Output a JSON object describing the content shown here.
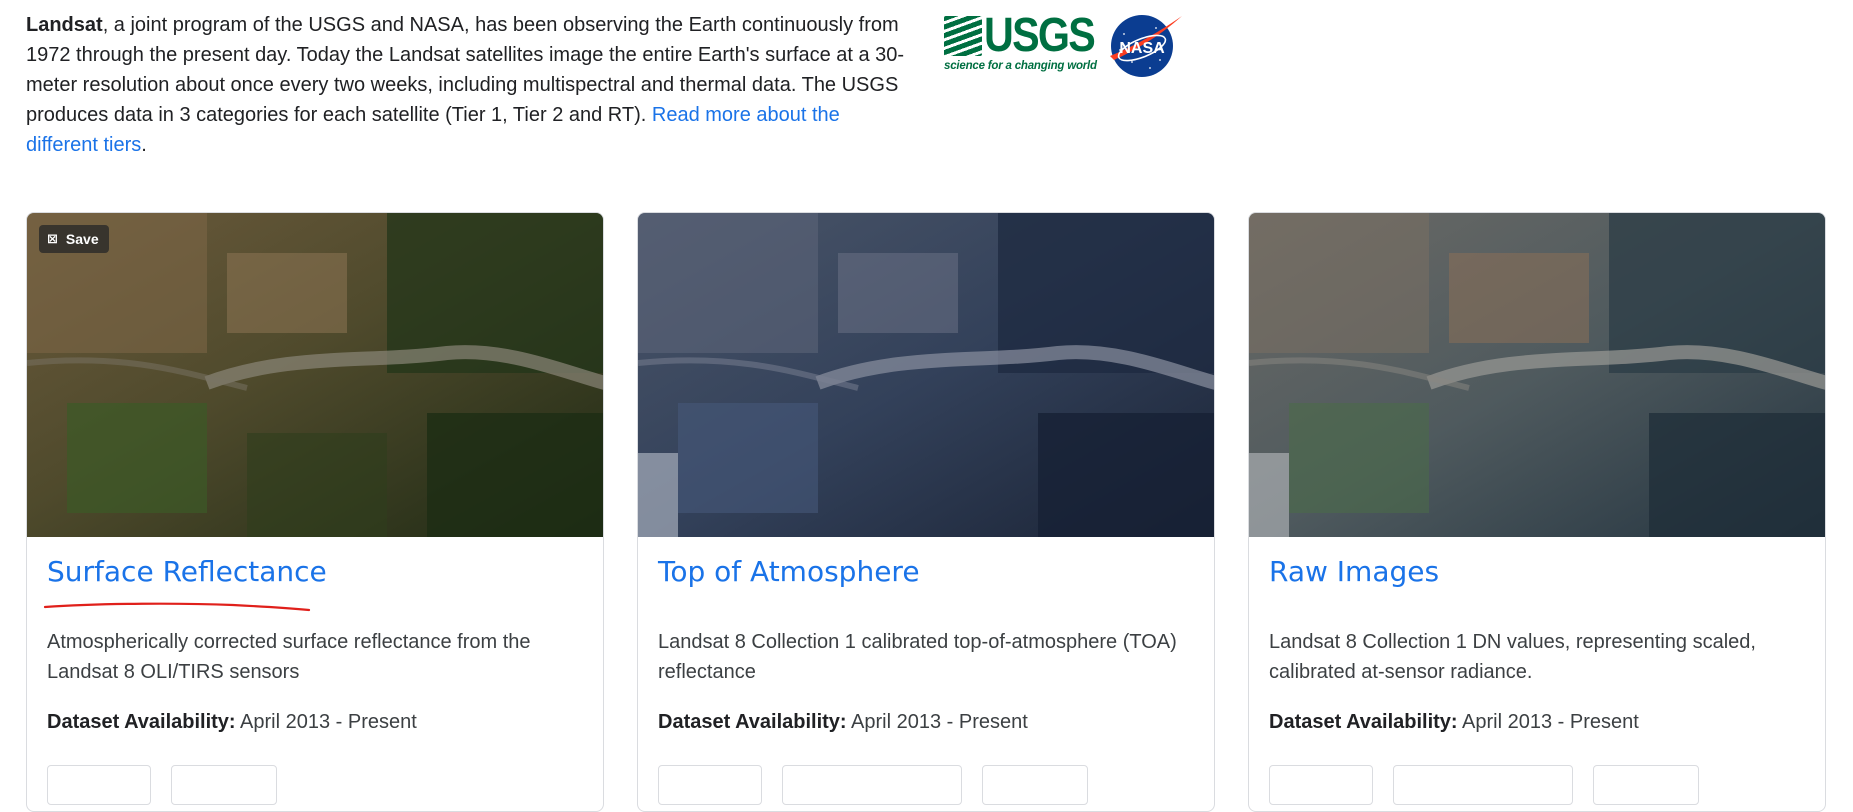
{
  "intro": {
    "bold_word": "Landsat",
    "text": ", a joint program of the USGS and NASA, has been observing the Earth continuously from 1972 through the present day. Today the Landsat satellites image the entire Earth's surface at a 30-meter resolution about once every two weeks, including multispectral and thermal data. The USGS produces data in 3 categories for each satellite (Tier 1, Tier 2 and RT). ",
    "link_text": "Read more about the different tiers",
    "trailing": "."
  },
  "logos": {
    "usgs_word": "USGS",
    "usgs_tagline": "science for a changing world",
    "nasa_word": "NASA"
  },
  "cards": [
    {
      "save_label": "Save",
      "title": "Surface Reflectance",
      "description": "Atmospherically corrected surface reflectance from the Landsat 8 OLI/TIRS sensors",
      "availability_label": "Dataset Availability:",
      "availability_value": " April 2013 - Present"
    },
    {
      "title": "Top of Atmosphere",
      "description": "Landsat 8 Collection 1 calibrated top-of-atmosphere (TOA) reflectance",
      "availability_label": "Dataset Availability:",
      "availability_value": " April 2013 - Present"
    },
    {
      "title": "Raw Images",
      "description": "Landsat 8 Collection 1 DN values, representing scaled, calibrated at-sensor radiance.",
      "availability_label": "Dataset Availability:",
      "availability_value": " April 2013 - Present"
    }
  ],
  "colors": {
    "link": "#1a73e8",
    "usgs_green": "#006f41",
    "nasa_blue": "#0b3d91",
    "nasa_red": "#fc3d21",
    "annotation_red": "#e0201b"
  },
  "icons": {
    "save": "bookmark-save-icon"
  }
}
